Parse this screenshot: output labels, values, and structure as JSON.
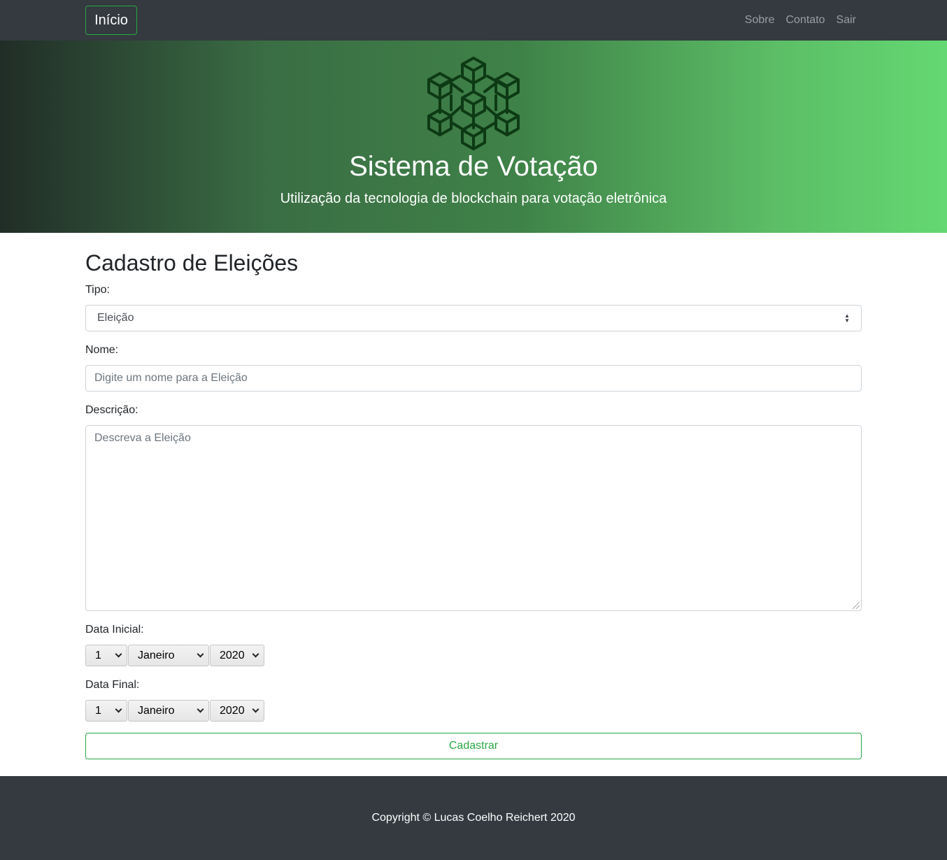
{
  "navbar": {
    "brand": "Início",
    "links": [
      "Sobre",
      "Contato",
      "Sair"
    ]
  },
  "hero": {
    "logo_icon": "blockchain-cubes-icon",
    "title": "Sistema de Votação",
    "subtitle": "Utilização da tecnologia de blockchain para votação eletrônica"
  },
  "form": {
    "title": "Cadastro de Eleições",
    "tipo_label": "Tipo:",
    "tipo_value": "Eleição",
    "nome_label": "Nome:",
    "nome_placeholder": "Digite um nome para a Eleição",
    "descricao_label": "Descrição:",
    "descricao_placeholder": "Descreva a Eleição",
    "data_inicial_label": "Data Inicial:",
    "data_inicial": {
      "day": "1",
      "month": "Janeiro",
      "year": "2020"
    },
    "data_final_label": "Data Final:",
    "data_final": {
      "day": "1",
      "month": "Janeiro",
      "year": "2020"
    },
    "submit_label": "Cadastrar"
  },
  "footer": {
    "copyright": "Copyright © Lucas Coelho Reichert 2020"
  },
  "colors": {
    "navbar_bg": "#343a40",
    "accent_green": "#28a745",
    "logo_stroke": "#0d3a14"
  }
}
